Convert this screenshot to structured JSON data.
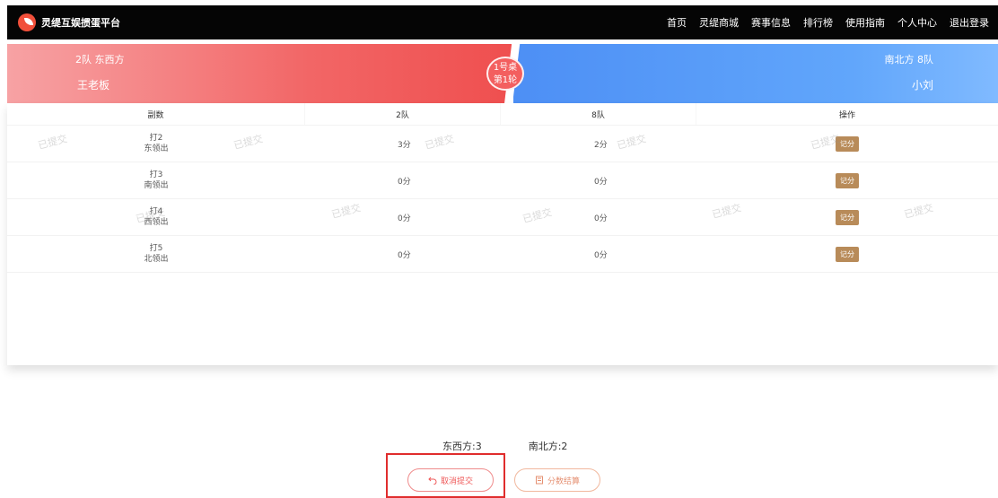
{
  "app": {
    "title": "灵缇互娱掼蛋平台",
    "logo_icon": "logo-icon"
  },
  "nav": {
    "items": [
      "首页",
      "灵缇商城",
      "赛事信息",
      "排行榜",
      "使用指南",
      "个人中心",
      "退出登录"
    ]
  },
  "banner": {
    "left_team": "2队 东西方",
    "left_player": "王老板",
    "right_team": "南北方 8队",
    "right_player": "小刘",
    "badge_table": "1号桌",
    "badge_round": "第1轮",
    "colors": {
      "left": "#f26666",
      "right": "#61a6fb"
    }
  },
  "table": {
    "headers": [
      "副数",
      "2队",
      "8队",
      "操作"
    ],
    "rows": [
      {
        "deal": "打2",
        "lead": "东领出",
        "team2": "3分",
        "team8": "2分",
        "action": "记分"
      },
      {
        "deal": "打3",
        "lead": "南领出",
        "team2": "0分",
        "team8": "0分",
        "action": "记分"
      },
      {
        "deal": "打4",
        "lead": "西领出",
        "team2": "0分",
        "team8": "0分",
        "action": "记分"
      },
      {
        "deal": "打5",
        "lead": "北领出",
        "team2": "0分",
        "team8": "0分",
        "action": "记分"
      }
    ],
    "watermark": "已提交"
  },
  "totals": {
    "east_west": "东西方:3",
    "north_south": "南北方:2"
  },
  "actions": {
    "cancel_label": "取消提交",
    "settle_label": "分数结算",
    "cancel_icon": "undo-icon",
    "settle_icon": "calculator-icon"
  }
}
